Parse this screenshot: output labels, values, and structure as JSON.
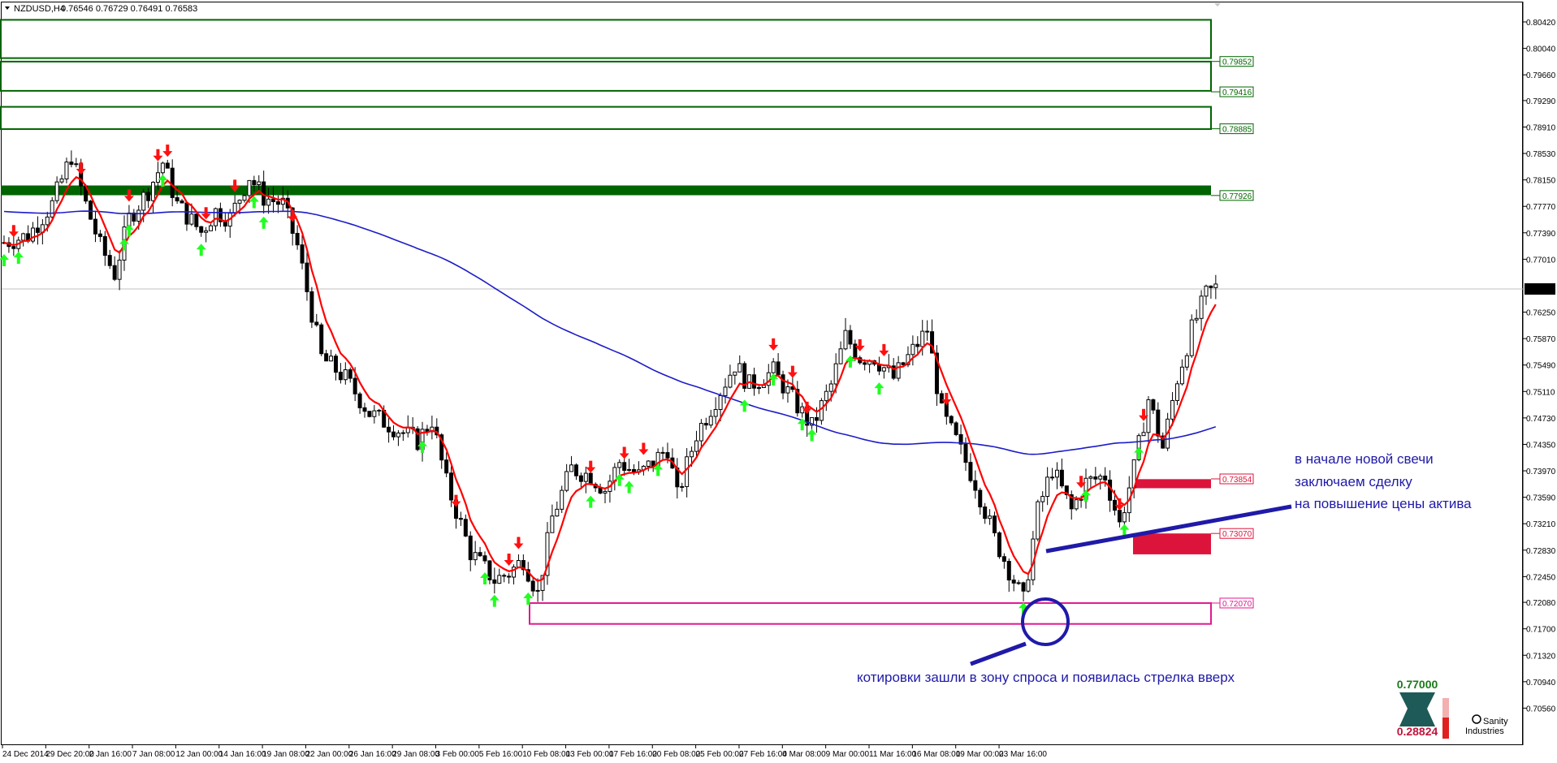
{
  "header": {
    "symbol": "NZDUSD,H4",
    "ohlc": "0.76546 0.76729 0.76491 0.76583"
  },
  "colors": {
    "bull_arrow": "#20ff20",
    "bear_arrow": "#ff1010",
    "supply_zone": "#006400",
    "demand_zone_pink": "#e01890",
    "demand_zone_red": "#dc143c",
    "fast_ma": "#ff0000",
    "slow_ma": "#1c1cc8",
    "annotation": "#1f1aa8"
  },
  "chart_data": {
    "type": "candlestick",
    "symbol": "NZDUSD",
    "timeframe": "H4",
    "ylim": [
      0.7004,
      0.807
    ],
    "y_ticks": [
      "0.80420",
      "0.80040",
      "0.79660",
      "0.79290",
      "0.78910",
      "0.78530",
      "0.78150",
      "0.77770",
      "0.77390",
      "0.77010",
      "0.76250",
      "0.75870",
      "0.75490",
      "0.75110",
      "0.74730",
      "0.74350",
      "0.73970",
      "0.73590",
      "0.73210",
      "0.72830",
      "0.72450",
      "0.72080",
      "0.71700",
      "0.71320",
      "0.70940",
      "0.70560"
    ],
    "x_ticks": [
      "24 Dec 2014",
      "29 Dec 20:00",
      "2 Jan 16:00",
      "7 Jan 08:00",
      "12 Jan 00:00",
      "14 Jan 16:00",
      "19 Jan 08:00",
      "22 Jan 00:00",
      "26 Jan 16:00",
      "29 Jan 08:00",
      "3 Feb 00:00",
      "5 Feb 16:00",
      "10 Feb 08:00",
      "13 Feb 00:00",
      "17 Feb 16:00",
      "20 Feb 08:00",
      "25 Feb 00:00",
      "27 Feb 16:00",
      "4 Mar 08:00",
      "9 Mar 00:00",
      "11 Mar 16:00",
      "16 Mar 08:00",
      "19 Mar 00:00",
      "23 Mar 16:00"
    ],
    "current_price": "0.76583",
    "price_anchors": [
      [
        0,
        0.7725
      ],
      [
        5,
        0.7735
      ],
      [
        10,
        0.778
      ],
      [
        14,
        0.785
      ],
      [
        17,
        0.778
      ],
      [
        20,
        0.772
      ],
      [
        23,
        0.768
      ],
      [
        26,
        0.776
      ],
      [
        30,
        0.78
      ],
      [
        33,
        0.784
      ],
      [
        36,
        0.778
      ],
      [
        41,
        0.774
      ],
      [
        44,
        0.777
      ],
      [
        47,
        0.776
      ],
      [
        51,
        0.782
      ],
      [
        54,
        0.779
      ],
      [
        58,
        0.778
      ],
      [
        61,
        0.772
      ],
      [
        66,
        0.756
      ],
      [
        71,
        0.753
      ],
      [
        76,
        0.748
      ],
      [
        81,
        0.746
      ],
      [
        86,
        0.744
      ],
      [
        89,
        0.747
      ],
      [
        92,
        0.738
      ],
      [
        97,
        0.728
      ],
      [
        102,
        0.724
      ],
      [
        105,
        0.725
      ],
      [
        108,
        0.727
      ],
      [
        111,
        0.722
      ],
      [
        114,
        0.733
      ],
      [
        118,
        0.74
      ],
      [
        122,
        0.739
      ],
      [
        125,
        0.737
      ],
      [
        128,
        0.741
      ],
      [
        132,
        0.739
      ],
      [
        135,
        0.741
      ],
      [
        138,
        0.743
      ],
      [
        140,
        0.736
      ],
      [
        144,
        0.745
      ],
      [
        148,
        0.75
      ],
      [
        152,
        0.755
      ],
      [
        155,
        0.752
      ],
      [
        160,
        0.754
      ],
      [
        164,
        0.75
      ],
      [
        168,
        0.746
      ],
      [
        172,
        0.752
      ],
      [
        175,
        0.759
      ],
      [
        178,
        0.756
      ],
      [
        181,
        0.756
      ],
      [
        185,
        0.753
      ],
      [
        189,
        0.757
      ],
      [
        192,
        0.76
      ],
      [
        195,
        0.748
      ],
      [
        198,
        0.744
      ],
      [
        202,
        0.738
      ],
      [
        206,
        0.73
      ],
      [
        210,
        0.724
      ],
      [
        212,
        0.721
      ],
      [
        215,
        0.734
      ],
      [
        218,
        0.74
      ],
      [
        222,
        0.734
      ],
      [
        225,
        0.738
      ],
      [
        229,
        0.739
      ],
      [
        232,
        0.732
      ],
      [
        235,
        0.74
      ],
      [
        238,
        0.75
      ],
      [
        241,
        0.743
      ],
      [
        244,
        0.753
      ],
      [
        247,
        0.76
      ],
      [
        250,
        0.765
      ],
      [
        252,
        0.766
      ]
    ],
    "bull_arrow_bars": [
      0,
      3,
      25,
      26,
      33,
      41,
      52,
      54,
      87,
      100,
      102,
      109,
      122,
      128,
      130,
      136,
      154,
      160,
      166,
      168,
      176,
      182,
      212,
      225,
      233,
      236
    ],
    "bear_arrow_bars": [
      2,
      16,
      26,
      32,
      34,
      42,
      48,
      60,
      94,
      105,
      107,
      122,
      129,
      133,
      160,
      164,
      167,
      178,
      183,
      196,
      224,
      232,
      237
    ]
  },
  "levels": [
    {
      "label": "0.79852",
      "price": 0.79852,
      "color": "#006400",
      "top": 0.8045,
      "bottom": 0.799,
      "filled": false
    },
    {
      "label": "0.79416",
      "price": 0.79416,
      "color": "#006400",
      "top": 0.7985,
      "bottom": 0.7943,
      "filled": false
    },
    {
      "label": "0.78885",
      "price": 0.78885,
      "color": "#006400",
      "top": 0.792,
      "bottom": 0.7888,
      "filled": false
    },
    {
      "label": "0.77926",
      "price": 0.77926,
      "color": "#006400",
      "top": 0.7807,
      "bottom": 0.7793,
      "filled": true
    },
    {
      "label": "0.73854",
      "price": 0.73854,
      "color": "#dc143c",
      "top": 0.7385,
      "bottom": 0.7372,
      "filled": true
    },
    {
      "label": "0.73070",
      "price": 0.7307,
      "color": "#dc143c",
      "top": 0.7307,
      "bottom": 0.7277,
      "filled": true
    },
    {
      "label": "0.72070",
      "price": 0.7207,
      "color": "#e01890",
      "top": 0.7207,
      "bottom": 0.7177,
      "filled": false
    }
  ],
  "annotations": {
    "right_note": [
      "в начале новой свечи",
      "заключаем сделку",
      "на повышение цены актива"
    ],
    "bottom_note": "котировки зашли в зону спроса и появилась стрелка вверх"
  },
  "widget": {
    "top_value": "0.77000",
    "bottom_value": "0.28824",
    "brand_line1": "Sanity",
    "brand_line2": "Industries"
  }
}
